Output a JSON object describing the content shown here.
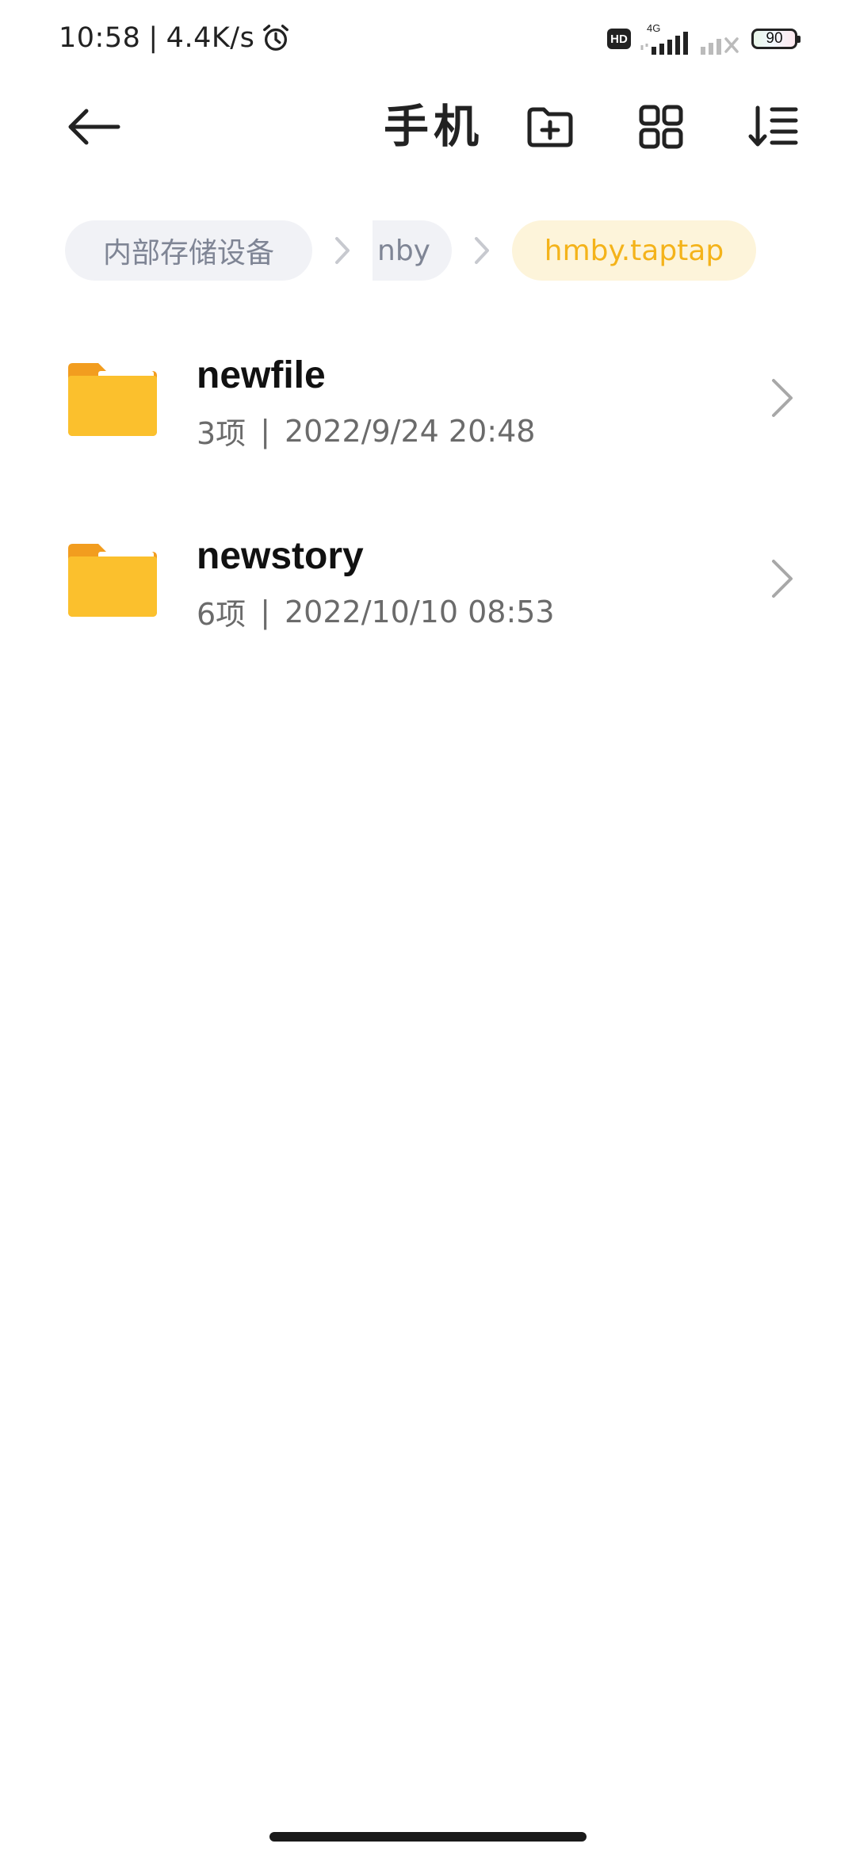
{
  "status_bar": {
    "time": "10:58",
    "network_speed": "4.4K/s",
    "separator": "|",
    "alarm_icon": "alarm-clock-icon",
    "hd_label": "HD",
    "network_type": "4G",
    "battery_level": "90"
  },
  "toolbar": {
    "title": "手机",
    "back_icon": "arrow-left-icon",
    "new_folder_icon": "folder-plus-icon",
    "grid_icon": "grid-view-icon",
    "sort_icon": "sort-icon"
  },
  "breadcrumbs": [
    {
      "label": "内部存储设备"
    },
    {
      "label": "nby"
    },
    {
      "label": "hmby.taptap"
    }
  ],
  "files": [
    {
      "name": "newfile",
      "count": "3项",
      "date": "2022/9/24 20:48"
    },
    {
      "name": "newstory",
      "count": "6项",
      "date": "2022/10/10 08:53"
    }
  ],
  "meta_separator": "|",
  "colors": {
    "accent": "#f4b31a",
    "folder": "#fbc02d",
    "chip_bg": "#f1f2f6",
    "chip_active_bg": "#fdf4da"
  }
}
